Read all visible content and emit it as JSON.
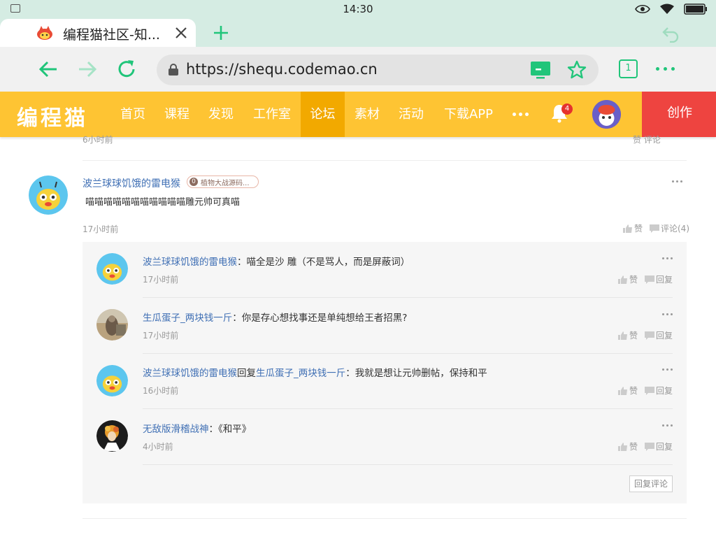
{
  "status_bar": {
    "time": "14:30"
  },
  "browser": {
    "tab_title": "编程猫社区-知...",
    "url": "https://shequ.codemao.cn",
    "tab_count": "1"
  },
  "site": {
    "logo": "编程猫",
    "nav": [
      {
        "label": "首页"
      },
      {
        "label": "课程"
      },
      {
        "label": "发现"
      },
      {
        "label": "工作室"
      },
      {
        "label": "论坛"
      },
      {
        "label": "素材"
      },
      {
        "label": "活动"
      },
      {
        "label": "下载APP"
      }
    ],
    "active_nav": "论坛",
    "notification_count": "4",
    "create_label": "创作"
  },
  "previous_post": {
    "time": "6小时前",
    "actions": "赞  评论"
  },
  "post": {
    "author": "波兰球球饥饿的雷电猴",
    "badge_number": "0",
    "badge_text": "植物大战源码...",
    "content": "喵喵喵喵喵喵喵喵喵喵喵雕元帅可真喵",
    "time": "17小时前",
    "like_label": "赞",
    "comment_label": "评论(4)"
  },
  "replies": [
    {
      "author": "波兰球球饥饿的雷电猴",
      "reply_to": "",
      "text": "：喵全是沙 雕（不是骂人，而是屏蔽词）",
      "time": "17小时前"
    },
    {
      "author": "生瓜蛋子_两块钱一斤",
      "reply_to": "",
      "text": "：你是存心想找事还是单纯想给王者招黑?",
      "time": "17小时前"
    },
    {
      "author": "波兰球球饥饿的雷电猴",
      "reply_word": "回复",
      "reply_to": "生瓜蛋子_两块钱一斤",
      "text": "：我就是想让元帅删帖，保持和平",
      "time": "16小时前"
    },
    {
      "author": "无敌版滑稽战神",
      "reply_to": "",
      "text": "：《和平》",
      "time": "4小时前"
    }
  ],
  "reply_like_label": "赞",
  "reply_reply_label": "回复",
  "reply_comment_button": "回复评论",
  "colors": {
    "accent_green": "#20c57a",
    "navbar_yellow": "#fec433",
    "navbar_active": "#f2a900",
    "create_red": "#ee4440",
    "link_blue": "#3f6fb4"
  }
}
